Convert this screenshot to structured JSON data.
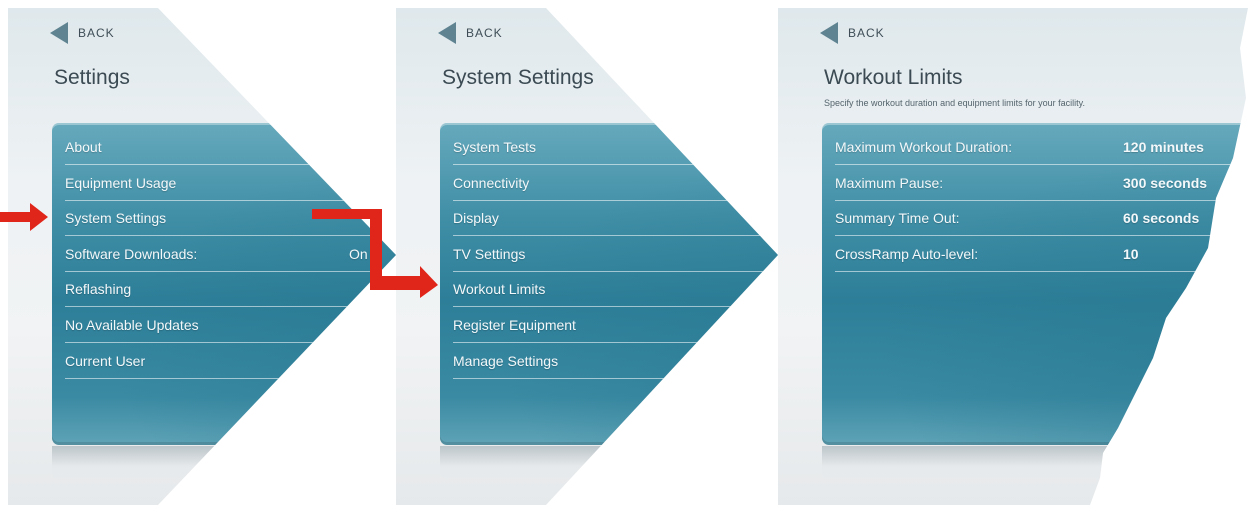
{
  "screens": [
    {
      "back_label": "BACK",
      "title": "Settings",
      "items": [
        {
          "label": "About"
        },
        {
          "label": "Equipment Usage"
        },
        {
          "label": "System Settings"
        },
        {
          "label": "Software Downloads:",
          "value": "On"
        },
        {
          "label": "Reflashing"
        },
        {
          "label": "No Available Updates"
        },
        {
          "label": "Current User"
        }
      ]
    },
    {
      "back_label": "BACK",
      "title": "System Settings",
      "items": [
        {
          "label": "System Tests"
        },
        {
          "label": "Connectivity"
        },
        {
          "label": "Display"
        },
        {
          "label": "TV Settings"
        },
        {
          "label": "Workout Limits"
        },
        {
          "label": "Register Equipment"
        },
        {
          "label": "Manage Settings"
        }
      ]
    },
    {
      "back_label": "BACK",
      "title": "Workout Limits",
      "subtitle": "Specify the workout duration and equipment limits for your facility.",
      "items": [
        {
          "label": "Maximum Workout Duration:",
          "value": "120 minutes"
        },
        {
          "label": "Maximum Pause:",
          "value": "300 seconds"
        },
        {
          "label": "Summary Time Out:",
          "value": "60 seconds"
        },
        {
          "label": "CrossRamp Auto-level:",
          "value": "10"
        }
      ]
    }
  ],
  "colors": {
    "panel": "#3f8ea6",
    "arrow": "#e0261b",
    "back_arrow": "#5f8391",
    "title": "#3b4a53"
  }
}
